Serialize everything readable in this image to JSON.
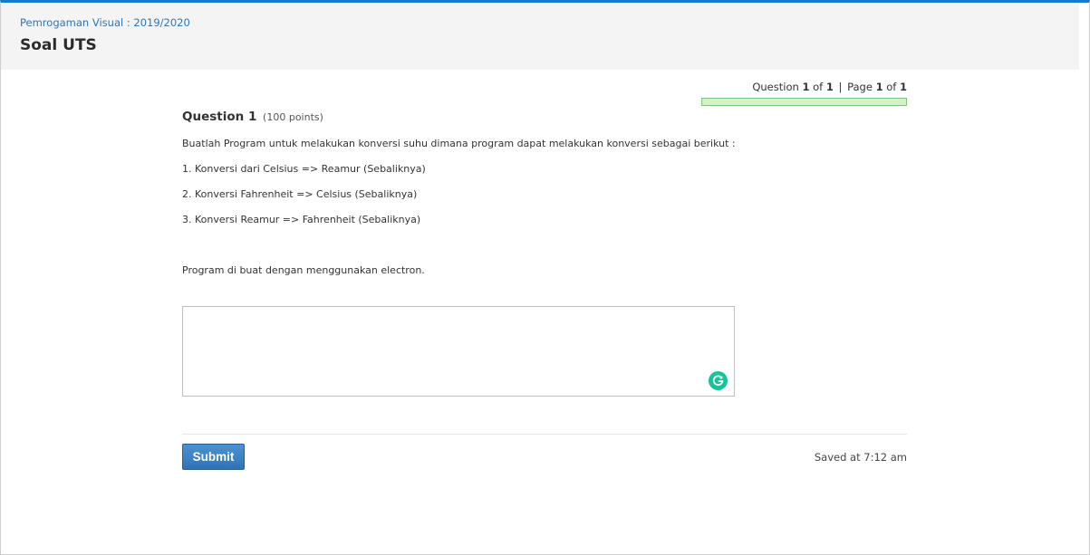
{
  "breadcrumb": {
    "course": "Pemrogaman Visual : 2019/2020"
  },
  "page": {
    "title": "Soal UTS"
  },
  "progress": {
    "question_label": "Question",
    "question_current": "1",
    "question_of": "of",
    "question_total": "1",
    "separator": "|",
    "page_label": "Page",
    "page_current": "1",
    "page_of": "of",
    "page_total": "1",
    "fraction_complete": 1.0
  },
  "question": {
    "title": "Question 1",
    "points": "(100 points)",
    "lines": [
      "Buatlah Program untuk melakukan konversi suhu dimana program dapat melakukan konversi sebagai berikut :",
      "1. Konversi dari Celsius => Reamur (Sebaliknya)",
      "2. Konversi Fahrenheit => Celsius (Sebaliknya)",
      "3. Konversi Reamur => Fahrenheit (Sebaliknya)",
      "Program di buat dengan menggunakan electron."
    ]
  },
  "answer": {
    "value": "",
    "placeholder": ""
  },
  "footer": {
    "submit_label": "Submit",
    "saved_status": "Saved at 7:12 am"
  },
  "icons": {
    "grammarly": "grammarly-icon"
  },
  "colors": {
    "accent": "#1a7ac8",
    "link": "#2f75b5",
    "submit": "#2f73b7",
    "grammarly": "#15c39a",
    "progress_fill": "#d6f0c8",
    "progress_border": "#7ec87e"
  }
}
